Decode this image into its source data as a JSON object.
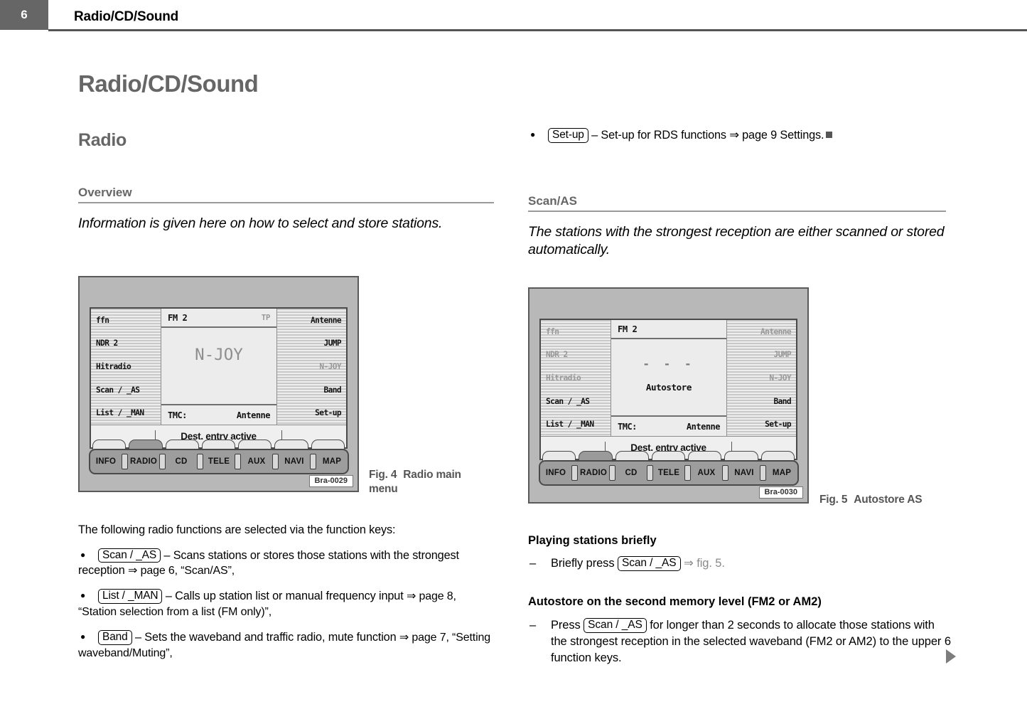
{
  "header": {
    "page_number": "6",
    "title": "Radio/CD/Sound"
  },
  "left_column": {
    "chapter_title": "Radio/CD/Sound",
    "section_title": "Radio",
    "subsection_title": "Overview",
    "lead_paragraph": "Information is given here on how to select and store stations.",
    "intro_text": "The following radio functions are selected via the function keys:",
    "bullets": [
      {
        "key": "Scan / _AS",
        "text_before_ref": " – Scans stations or stores those stations with the strongest reception ",
        "ref": "⇒ page 6, “Scan/AS”,"
      },
      {
        "key": "List / _MAN",
        "text_before_ref": " – Calls up station list or manual frequency input ",
        "ref": "⇒ page 8, “Station selection from a list (FM only)”,"
      },
      {
        "key": "Band",
        "text_before_ref": " – Sets the waveband and traffic radio, mute function ",
        "ref": "⇒ page 7, “Setting waveband/Muting”,"
      }
    ]
  },
  "right_column": {
    "top_bullet": {
      "key": "Set-up",
      "text": " – Set-up for RDS functions ⇒ page 9 Settings."
    },
    "subsection_title": "Scan/AS",
    "lead_paragraph": "The stations with the strongest reception are either scanned or stored automatically.",
    "block_1": {
      "heading": "Playing stations briefly",
      "dash": "–",
      "text_before_key": "Briefly press ",
      "key": "Scan / _AS",
      "ref": "⇒ fig. 5."
    },
    "block_2": {
      "heading": "Autostore on the second memory level (FM2 or AM2)",
      "dash": "–",
      "text_before_key": "Press ",
      "key": "Scan / _AS",
      "text_after_key": " for longer than 2 seconds to allocate those stations with the strongest reception in the selected waveband (FM2 or AM2) to the upper 6 function keys."
    }
  },
  "figure_4": {
    "caption_label": "Fig. 4",
    "caption_text": "Radio main menu",
    "badge": "Bra-0029",
    "screen": {
      "left_items": [
        {
          "label": "ffn",
          "dim": false
        },
        {
          "label": "NDR 2",
          "dim": false
        },
        {
          "label": "Hitradio",
          "dim": false
        },
        {
          "label": "Scan / _AS",
          "dim": false
        },
        {
          "label": "List / _MAN",
          "dim": false
        }
      ],
      "right_items": [
        {
          "label": "Antenne",
          "dim": false
        },
        {
          "label": "JUMP",
          "dim": false
        },
        {
          "label": "N-JOY",
          "dim": true
        },
        {
          "label": "Band",
          "dim": false
        },
        {
          "label": "Set-up",
          "dim": false
        }
      ],
      "band": "FM 2",
      "tp": "TP",
      "station": "N-JOY",
      "tmc_label": "TMC:",
      "tmc_value": "Antenne",
      "status": "Dest. entry active"
    },
    "keybar": [
      "INFO",
      "RADIO",
      "CD",
      "TELE",
      "AUX",
      "NAVI",
      "MAP"
    ]
  },
  "figure_5": {
    "caption_label": "Fig. 5",
    "caption_text": "Autostore AS",
    "badge": "Bra-0030",
    "screen": {
      "left_items": [
        {
          "label": "ffn",
          "dim": true
        },
        {
          "label": "NDR 2",
          "dim": true
        },
        {
          "label": "Hitradio",
          "dim": true
        },
        {
          "label": "Scan / _AS",
          "dim": false
        },
        {
          "label": "List / _MAN",
          "dim": false
        }
      ],
      "right_items": [
        {
          "label": "Antenne",
          "dim": true
        },
        {
          "label": "JUMP",
          "dim": true
        },
        {
          "label": "N-JOY",
          "dim": true
        },
        {
          "label": "Band",
          "dim": false
        },
        {
          "label": "Set-up",
          "dim": false
        }
      ],
      "band": "FM 2",
      "tp": "",
      "dashes": "- - -",
      "autostore": "Autostore",
      "tmc_label": "TMC:",
      "tmc_value": "Antenne",
      "status": "Dest. entry active"
    },
    "keybar": [
      "INFO",
      "RADIO",
      "CD",
      "TELE",
      "AUX",
      "NAVI",
      "MAP"
    ]
  }
}
